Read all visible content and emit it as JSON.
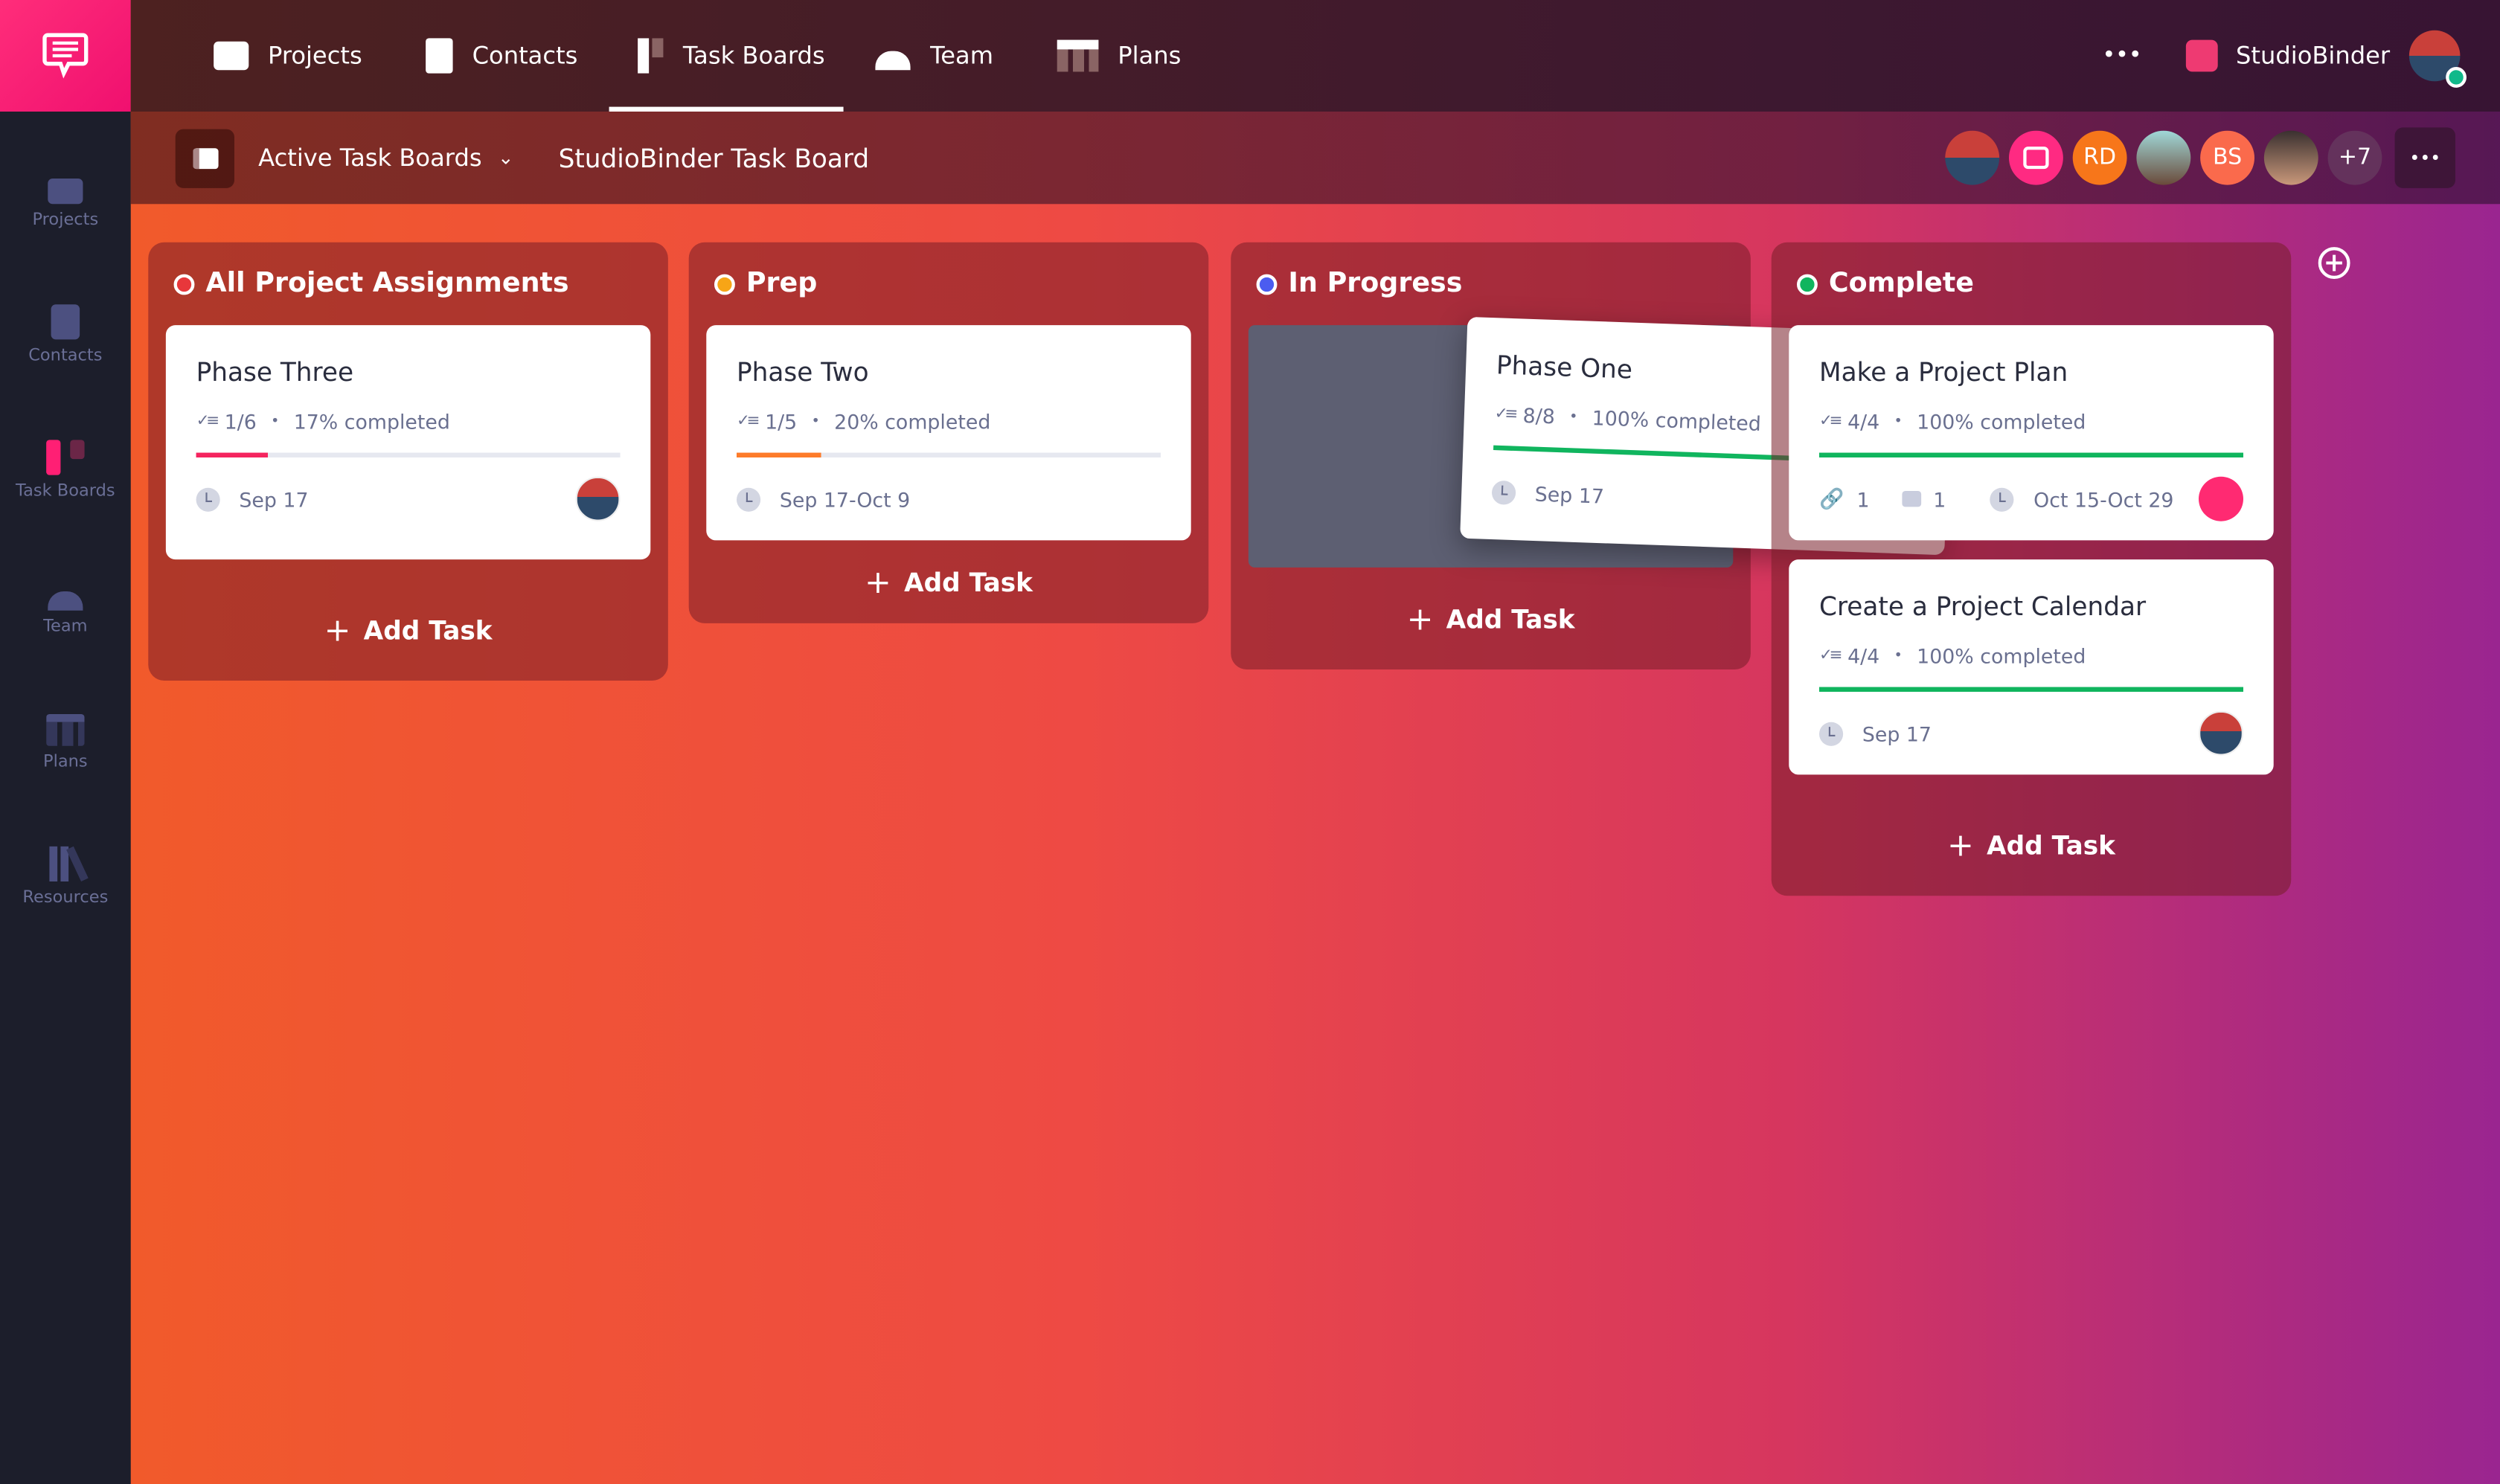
{
  "brand": {
    "accent": "#ff1f74",
    "logo_icon": "chat-bubble-icon"
  },
  "sidebar": {
    "items": [
      {
        "label": "Projects",
        "icon": "briefcase-icon"
      },
      {
        "label": "Contacts",
        "icon": "contact-card-icon"
      },
      {
        "label": "Task Boards",
        "icon": "task-board-icon",
        "active": true
      },
      {
        "label": "Team",
        "icon": "team-icon"
      },
      {
        "label": "Plans",
        "icon": "plans-icon"
      },
      {
        "label": "Resources",
        "icon": "books-icon"
      }
    ]
  },
  "topnav": {
    "items": [
      {
        "label": "Projects",
        "icon": "briefcase-icon"
      },
      {
        "label": "Contacts",
        "icon": "contact-card-icon"
      },
      {
        "label": "Task Boards",
        "icon": "task-board-icon",
        "active": true
      },
      {
        "label": "Team",
        "icon": "team-icon"
      },
      {
        "label": "Plans",
        "icon": "plans-icon"
      }
    ],
    "more": "•••",
    "account": "StudioBinder"
  },
  "subbar": {
    "board_selector": "Active Task Boards",
    "board_title": "StudioBinder Task Board",
    "members": [
      "",
      "",
      "RD",
      "",
      "BS",
      ""
    ],
    "more_members": "+7",
    "menu": "•••"
  },
  "columns": [
    {
      "title": "All Project Assignments",
      "color": "#e8373b",
      "add": "Add Task",
      "cards": [
        {
          "title": "Phase Three",
          "checklist": "1/6",
          "progress_text": "17% completed",
          "progress": 17,
          "bar_color": "#f5245f",
          "date": "Sep 17"
        }
      ]
    },
    {
      "title": "Prep",
      "color": "#f7a516",
      "add": "Add Task",
      "cards": [
        {
          "title": "Phase Two",
          "checklist": "1/5",
          "progress_text": "20% completed",
          "progress": 20,
          "bar_color": "#fd7b2a",
          "date": "Sep 17-Oct 9"
        }
      ]
    },
    {
      "title": "In Progress",
      "color": "#4b5cf0",
      "add": "Add Task",
      "cards": [
        {
          "title": "Phase One",
          "checklist": "8/8",
          "progress_text": "100% completed",
          "progress": 100,
          "bar_color": "#10b55e",
          "date": "Sep 17",
          "dragging": true
        }
      ]
    },
    {
      "title": "Complete",
      "color": "#10b55e",
      "add": "Add Task",
      "cards": [
        {
          "title": "Make a Project Plan",
          "checklist": "4/4",
          "progress_text": "100% completed",
          "progress": 100,
          "bar_color": "#10b55e",
          "attachments": "1",
          "comments": "1",
          "date": "Oct 15-Oct 29"
        },
        {
          "title": "Create a Project Calendar",
          "checklist": "4/4",
          "progress_text": "100% completed",
          "progress": 100,
          "bar_color": "#10b55e",
          "date": "Sep 17"
        }
      ]
    }
  ],
  "add_column": "+",
  "bullet": "•"
}
